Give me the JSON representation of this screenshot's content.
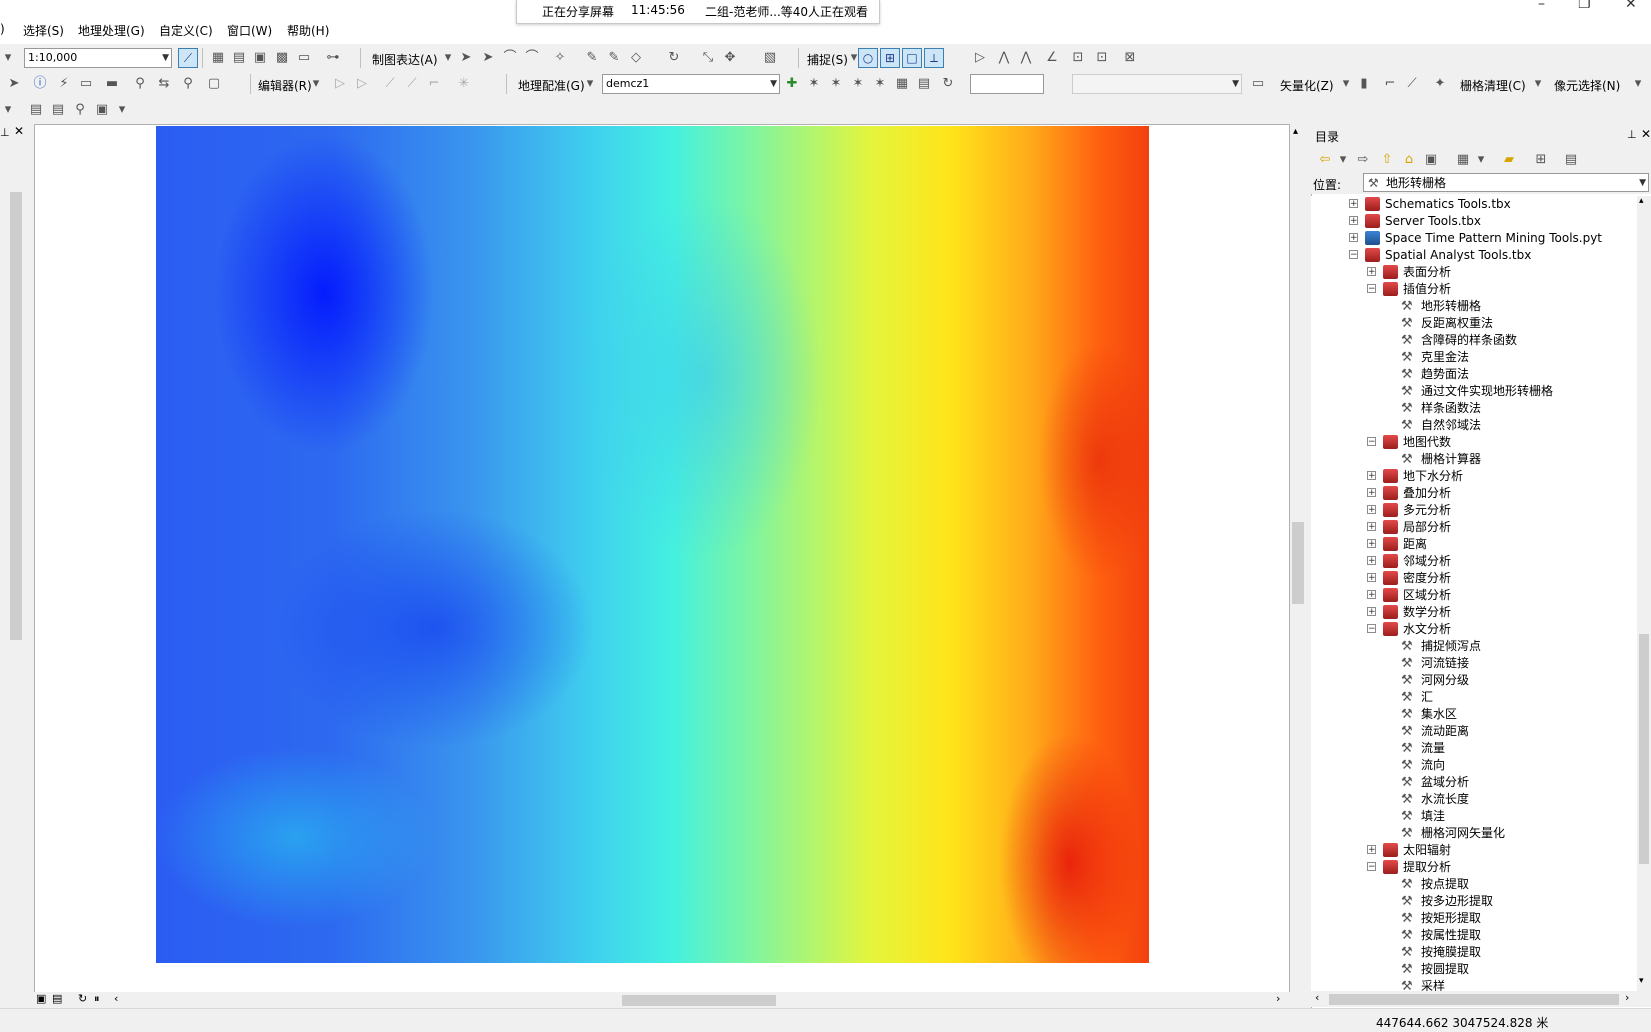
{
  "menu": {
    "items": [
      "选择(S)",
      "地理处理(G)",
      "自定义(C)",
      "窗口(W)",
      "帮助(H)"
    ],
    "left_fragment": ")"
  },
  "share_banner": {
    "status": "正在分享屏幕",
    "time": "11:45:56",
    "viewers": "二组-范老师...等40人正在观看"
  },
  "toolbar1": {
    "scale": "1:10,000",
    "draw_label": "制图表达(A)",
    "snap_label": "捕捉(S)"
  },
  "toolbar2": {
    "editor_label": "编辑器(R)",
    "georef_label": "地理配准(G)",
    "layer_select": "demcz1",
    "vectorize_label": "矢量化(Z)",
    "raster_clean_label": "栅格清理(C)",
    "cell_select_label": "像元选择(N)"
  },
  "catalog": {
    "title": "目录",
    "location_label": "位置:",
    "location_value": "地形转栅格",
    "tree": [
      {
        "label": "Schematics Tools.tbx",
        "level": 0,
        "type": "toolbox",
        "expand": "+"
      },
      {
        "label": "Server Tools.tbx",
        "level": 0,
        "type": "toolbox",
        "expand": "+"
      },
      {
        "label": "Space Time Pattern Mining Tools.pyt",
        "level": 0,
        "type": "pytoolbox",
        "expand": "+"
      },
      {
        "label": "Spatial Analyst Tools.tbx",
        "level": 0,
        "type": "toolbox",
        "expand": "−"
      },
      {
        "label": "表面分析",
        "level": 1,
        "type": "toolset",
        "expand": "+"
      },
      {
        "label": "插值分析",
        "level": 1,
        "type": "toolset",
        "expand": "−"
      },
      {
        "label": "地形转栅格",
        "level": 2,
        "type": "tool"
      },
      {
        "label": "反距离权重法",
        "level": 2,
        "type": "tool"
      },
      {
        "label": "含障碍的样条函数",
        "level": 2,
        "type": "tool"
      },
      {
        "label": "克里金法",
        "level": 2,
        "type": "tool"
      },
      {
        "label": "趋势面法",
        "level": 2,
        "type": "tool"
      },
      {
        "label": "通过文件实现地形转栅格",
        "level": 2,
        "type": "tool"
      },
      {
        "label": "样条函数法",
        "level": 2,
        "type": "tool"
      },
      {
        "label": "自然邻域法",
        "level": 2,
        "type": "tool"
      },
      {
        "label": "地图代数",
        "level": 1,
        "type": "toolset",
        "expand": "−"
      },
      {
        "label": "栅格计算器",
        "level": 2,
        "type": "tool"
      },
      {
        "label": "地下水分析",
        "level": 1,
        "type": "toolset",
        "expand": "+"
      },
      {
        "label": "叠加分析",
        "level": 1,
        "type": "toolset",
        "expand": "+"
      },
      {
        "label": "多元分析",
        "level": 1,
        "type": "toolset",
        "expand": "+"
      },
      {
        "label": "局部分析",
        "level": 1,
        "type": "toolset",
        "expand": "+"
      },
      {
        "label": "距离",
        "level": 1,
        "type": "toolset",
        "expand": "+"
      },
      {
        "label": "邻域分析",
        "level": 1,
        "type": "toolset",
        "expand": "+"
      },
      {
        "label": "密度分析",
        "level": 1,
        "type": "toolset",
        "expand": "+"
      },
      {
        "label": "区域分析",
        "level": 1,
        "type": "toolset",
        "expand": "+"
      },
      {
        "label": "数学分析",
        "level": 1,
        "type": "toolset",
        "expand": "+"
      },
      {
        "label": "水文分析",
        "level": 1,
        "type": "toolset",
        "expand": "−"
      },
      {
        "label": "捕捉倾泻点",
        "level": 2,
        "type": "tool"
      },
      {
        "label": "河流链接",
        "level": 2,
        "type": "tool"
      },
      {
        "label": "河网分级",
        "level": 2,
        "type": "tool"
      },
      {
        "label": "汇",
        "level": 2,
        "type": "tool"
      },
      {
        "label": "集水区",
        "level": 2,
        "type": "tool"
      },
      {
        "label": "流动距离",
        "level": 2,
        "type": "tool"
      },
      {
        "label": "流量",
        "level": 2,
        "type": "tool"
      },
      {
        "label": "流向",
        "level": 2,
        "type": "tool"
      },
      {
        "label": "盆域分析",
        "level": 2,
        "type": "tool"
      },
      {
        "label": "水流长度",
        "level": 2,
        "type": "tool"
      },
      {
        "label": "填洼",
        "level": 2,
        "type": "tool"
      },
      {
        "label": "栅格河网矢量化",
        "level": 2,
        "type": "tool"
      },
      {
        "label": "太阳辐射",
        "level": 1,
        "type": "toolset",
        "expand": "+"
      },
      {
        "label": "提取分析",
        "level": 1,
        "type": "toolset",
        "expand": "−"
      },
      {
        "label": "按点提取",
        "level": 2,
        "type": "tool"
      },
      {
        "label": "按多边形提取",
        "level": 2,
        "type": "tool"
      },
      {
        "label": "按矩形提取",
        "level": 2,
        "type": "tool"
      },
      {
        "label": "按属性提取",
        "level": 2,
        "type": "tool"
      },
      {
        "label": "按掩膜提取",
        "level": 2,
        "type": "tool"
      },
      {
        "label": "按圆提取",
        "level": 2,
        "type": "tool"
      },
      {
        "label": "采样",
        "level": 2,
        "type": "tool"
      }
    ]
  },
  "status": {
    "coordinates": "447644.662  3047524.828 米"
  },
  "colors": {
    "selection_blue": "#cde6f7",
    "toolbox_red": "#c0392b"
  }
}
